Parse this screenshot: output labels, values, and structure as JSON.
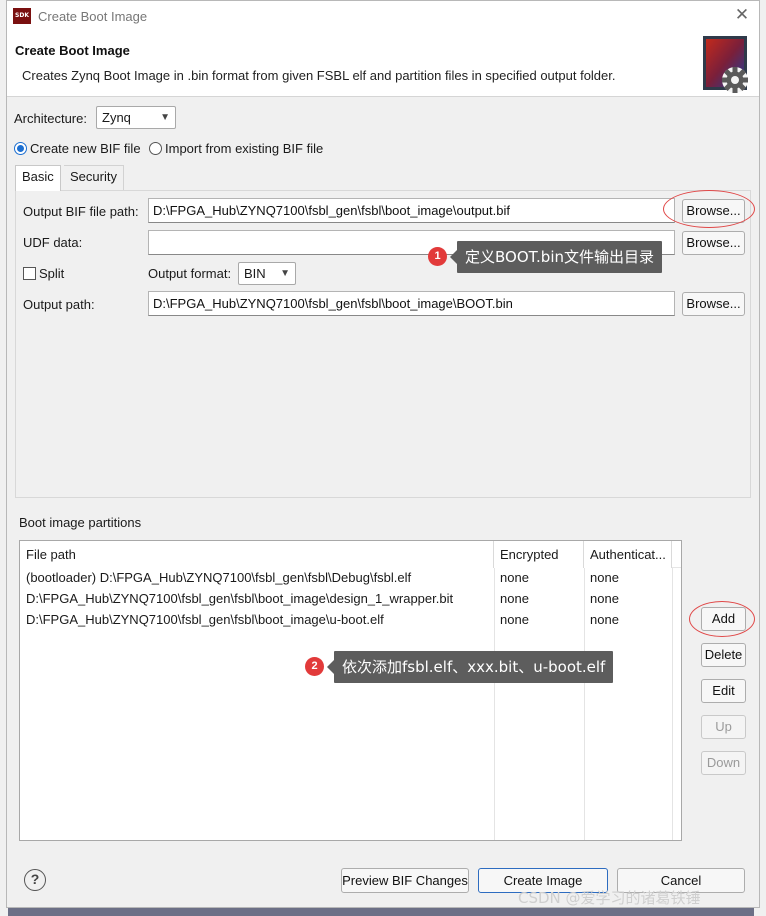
{
  "window": {
    "title": "Create Boot Image",
    "app_icon_text": "SDK"
  },
  "header": {
    "title": "Create Boot Image",
    "description": "Creates Zynq Boot Image in .bin format from given FSBL elf and partition files in specified output folder."
  },
  "architecture": {
    "label": "Architecture:",
    "value": "Zynq"
  },
  "bif_mode": {
    "option_new": "Create new BIF file",
    "option_import": "Import from existing BIF file",
    "selected": "new"
  },
  "tabs": [
    {
      "label": "Basic",
      "active": true
    },
    {
      "label": "Security",
      "active": false
    }
  ],
  "basic": {
    "output_bif_label": "Output BIF file path:",
    "output_bif_value": "D:\\FPGA_Hub\\ZYNQ7100\\fsbl_gen\\fsbl\\boot_image\\output.bif",
    "udf_label": "UDF data:",
    "udf_value": "",
    "split_label": "Split",
    "output_format_label": "Output format:",
    "output_format_value": "BIN",
    "output_path_label": "Output path:",
    "output_path_value": "D:\\FPGA_Hub\\ZYNQ7100\\fsbl_gen\\fsbl\\boot_image\\BOOT.bin",
    "browse_label": "Browse..."
  },
  "partitions": {
    "section_label": "Boot image partitions",
    "columns": [
      "File path",
      "Encrypted",
      "Authenticat..."
    ],
    "rows": [
      {
        "path": "(bootloader) D:\\FPGA_Hub\\ZYNQ7100\\fsbl_gen\\fsbl\\Debug\\fsbl.elf",
        "encrypted": "none",
        "authenticated": "none"
      },
      {
        "path": "D:\\FPGA_Hub\\ZYNQ7100\\fsbl_gen\\fsbl\\boot_image\\design_1_wrapper.bit",
        "encrypted": "none",
        "authenticated": "none"
      },
      {
        "path": "D:\\FPGA_Hub\\ZYNQ7100\\fsbl_gen\\fsbl\\boot_image\\u-boot.elf",
        "encrypted": "none",
        "authenticated": "none"
      }
    ],
    "buttons": {
      "add": "Add",
      "delete": "Delete",
      "edit": "Edit",
      "up": "Up",
      "down": "Down"
    }
  },
  "annotations": [
    {
      "number": "1",
      "text": "定义BOOT.bin文件输出目录"
    },
    {
      "number": "2",
      "text": "依次添加fsbl.elf、xxx.bit、u-boot.elf"
    }
  ],
  "footer": {
    "help": "?",
    "preview": "Preview BIF Changes",
    "create": "Create Image",
    "cancel": "Cancel"
  },
  "watermark": "CSDN @爱学习的诸葛铁锤",
  "colors": {
    "annotation_red": "#e23a3a",
    "callout_bg": "#5d5d5d",
    "primary_border": "#2d6cc0"
  }
}
